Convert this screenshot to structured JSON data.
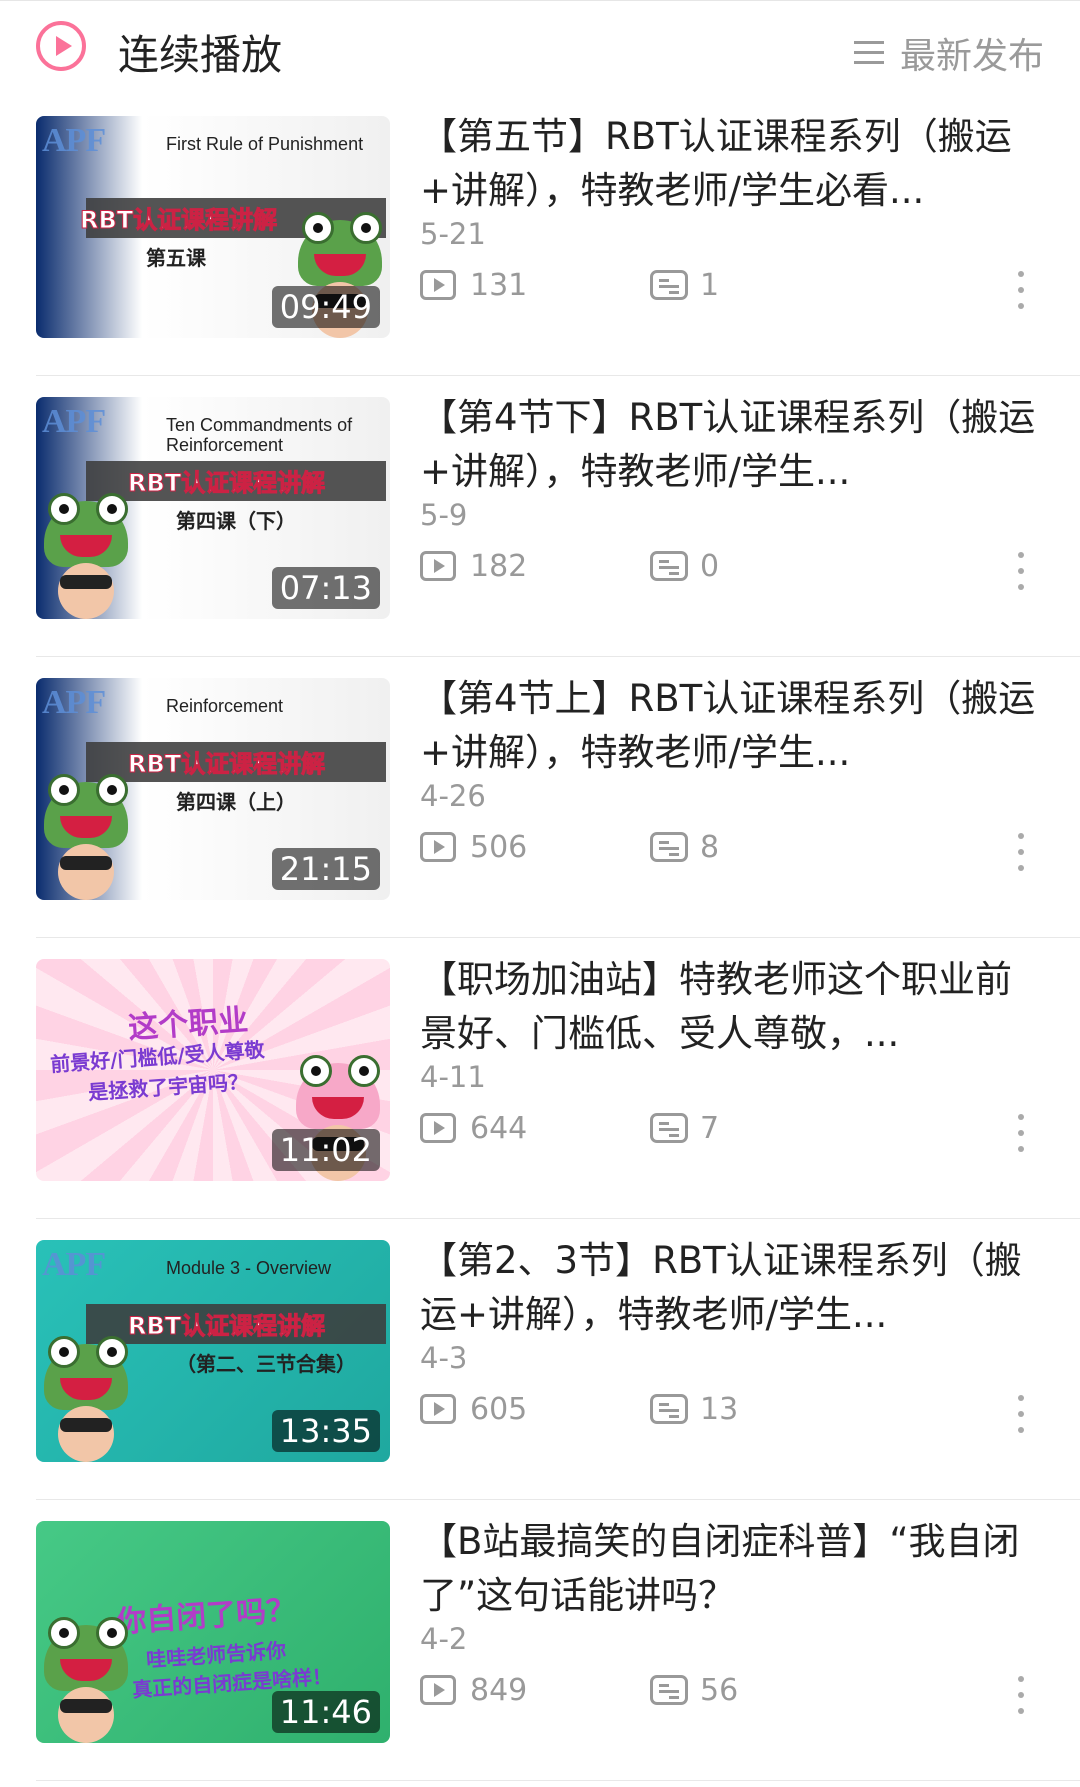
{
  "header": {
    "autoplay_label": "连续播放",
    "sort_label": "最新发布",
    "accent_color": "#fb7299"
  },
  "videos": [
    {
      "title": "【第五节】RBT认证课程系列（搬运+讲解），特教老师/学生必看...",
      "date": "5-21",
      "views": "131",
      "danmaku": "1",
      "duration": "09:49",
      "thumb_title": "First Rule of Punishment",
      "thumb_main": "RBT认证课程讲解",
      "thumb_sub": "第五课",
      "thumb_bg": "linear-gradient(90deg,#0a2c6e 0%,#ffffff 30%,#f0f0f0 100%)"
    },
    {
      "title": "【第4节下】RBT认证课程系列（搬运+讲解），特教老师/学生...",
      "date": "5-9",
      "views": "182",
      "danmaku": "0",
      "duration": "07:13",
      "thumb_title": "Ten Commandments of Reinforcement",
      "thumb_main": "RBT认证课程讲解",
      "thumb_sub": "第四课（下）",
      "thumb_bg": "linear-gradient(90deg,#0a2c6e 0%,#ffffff 30%,#f0f0f0 100%)"
    },
    {
      "title": "【第4节上】RBT认证课程系列（搬运+讲解），特教老师/学生...",
      "date": "4-26",
      "views": "506",
      "danmaku": "8",
      "duration": "21:15",
      "thumb_title": "Reinforcement",
      "thumb_main": "RBT认证课程讲解",
      "thumb_sub": "第四课（上）",
      "thumb_bg": "linear-gradient(90deg,#0a2c6e 0%,#ffffff 30%,#f0f0f0 100%)"
    },
    {
      "title": "【职场加油站】特教老师这个职业前景好、门槛低、受人尊敬，...",
      "date": "4-11",
      "views": "644",
      "danmaku": "7",
      "duration": "11:02",
      "thumb_title": "",
      "thumb_main": "这个职业",
      "thumb_sub": "前景好/门槛低/受人尊敬",
      "thumb_sub2": "是拯救了宇宙吗？",
      "thumb_bg": "repeating-conic-gradient(from 0deg at 50% 50%,#ffd3e4 0deg 10deg,#ffe8f0 10deg 20deg)"
    },
    {
      "title": "【第2、3节】RBT认证课程系列（搬运+讲解），特教老师/学生...",
      "date": "4-3",
      "views": "605",
      "danmaku": "13",
      "duration": "13:35",
      "thumb_title": "Module 3 - Overview",
      "thumb_main": "RBT认证课程讲解",
      "thumb_sub": "（第二、三节合集）",
      "thumb_bg": "linear-gradient(135deg,#29c1b8 0%,#1fa89f 100%)"
    },
    {
      "title": "【B站最搞笑的自闭症科普】“我自闭了”这句话能讲吗？",
      "date": "4-2",
      "views": "849",
      "danmaku": "56",
      "duration": "11:46",
      "thumb_title": "",
      "thumb_main": "你自闭了吗？",
      "thumb_sub": "哇哇老师告诉你",
      "thumb_sub2": "真正的自闭症是啥样！",
      "thumb_bg": "linear-gradient(135deg,#46c986 0%,#2fb06d 100%)"
    }
  ]
}
